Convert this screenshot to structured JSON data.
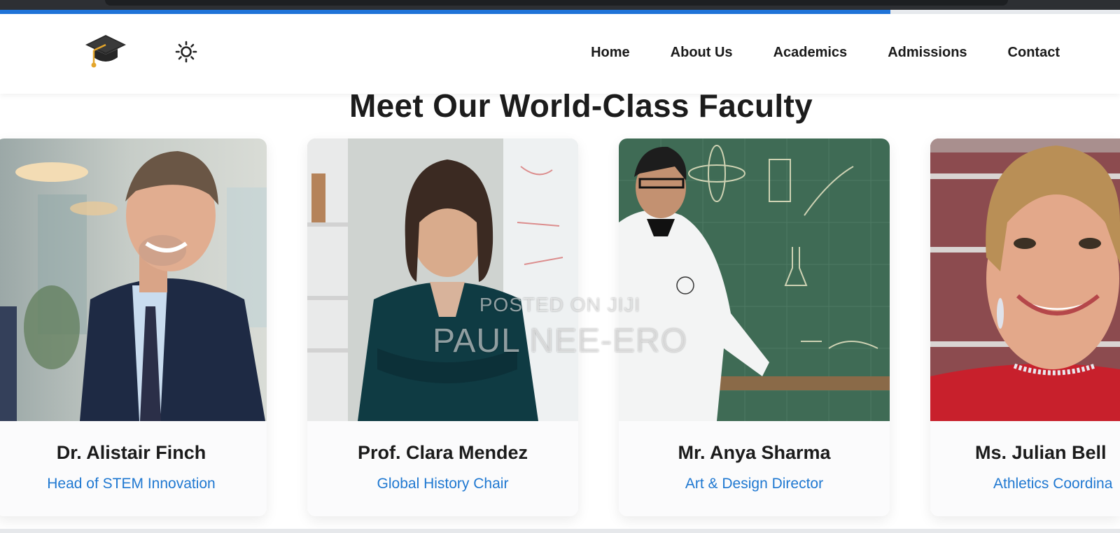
{
  "progress": 0.795,
  "colors": {
    "accent": "#1f73d8",
    "role_text": "#1f78d1",
    "heading": "#1c1c1c"
  },
  "header": {
    "logo_icon": "graduation-cap-icon",
    "theme_icon": "sun-icon",
    "nav": [
      {
        "label": "Home"
      },
      {
        "label": "About Us"
      },
      {
        "label": "Academics"
      },
      {
        "label": "Admissions"
      },
      {
        "label": "Contact"
      }
    ]
  },
  "section": {
    "title": "Meet Our World-Class Faculty"
  },
  "faculty": [
    {
      "name": "Dr. Alistair Finch",
      "role": "Head of STEM Innovation"
    },
    {
      "name": "Prof. Clara Mendez",
      "role": "Global History Chair"
    },
    {
      "name": "Mr. Anya Sharma",
      "role": "Art & Design Director"
    },
    {
      "name": "Ms. Julian Bell",
      "role": "Athletics Coordina"
    }
  ],
  "watermark": {
    "line1": "POSTED ON JIJI",
    "line2": "PAUL NEE-ERO"
  }
}
